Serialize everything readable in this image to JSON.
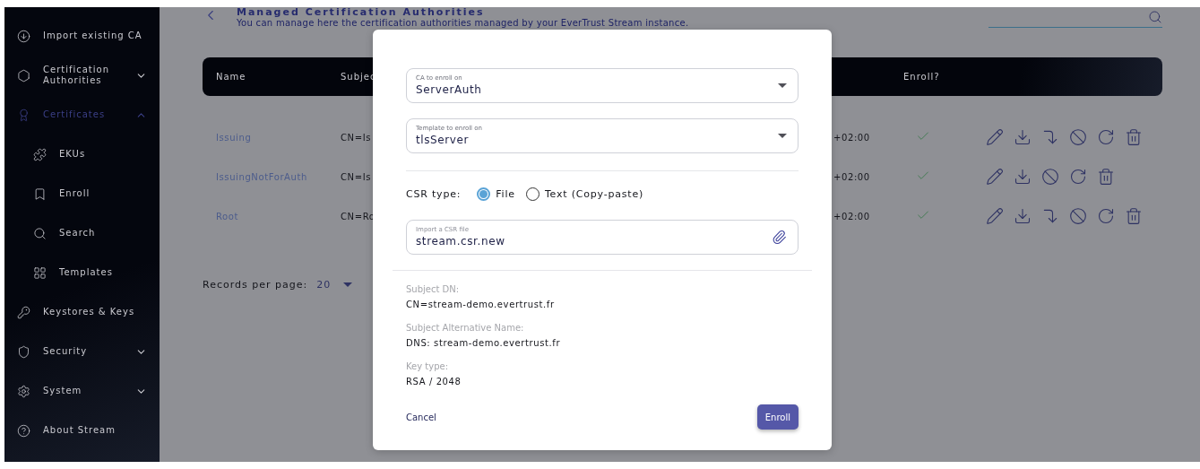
{
  "sidebar": {
    "items": [
      {
        "label": "Import existing CA",
        "selected": false
      },
      {
        "label": "Certification Authorities",
        "selected": false,
        "expanded": false
      },
      {
        "label": "Certificates",
        "selected": true,
        "expanded": true,
        "children": [
          {
            "label": "EKUs",
            "selected": false
          },
          {
            "label": "Enroll",
            "selected": false
          },
          {
            "label": "Search",
            "selected": false
          },
          {
            "label": "Templates",
            "selected": false
          }
        ]
      },
      {
        "label": "Keystores & Keys",
        "selected": false
      },
      {
        "label": "Security",
        "selected": false,
        "expanded": false
      },
      {
        "label": "System",
        "selected": false,
        "expanded": false
      },
      {
        "label": "About Stream",
        "selected": false
      }
    ]
  },
  "page": {
    "title": "Managed Certification Authorities",
    "subtitle": "You can manage here the certification authorities managed by your EverTrust Stream instance."
  },
  "table": {
    "columns": [
      "Name",
      "Subjec",
      "Enroll?"
    ],
    "rows": [
      {
        "name": "Issuing",
        "subject": "CN=Is",
        "date": "+02:00",
        "enroll": true,
        "actions": [
          {
            "kind": "edit"
          },
          {
            "kind": "download"
          },
          {
            "kind": "forward"
          },
          {
            "kind": "revoke"
          },
          {
            "kind": "refresh"
          },
          {
            "kind": "delete"
          }
        ]
      },
      {
        "name": "IssuingNotForAuth",
        "subject": "CN=Is",
        "date": "+02:00",
        "enroll": true,
        "actions": [
          {
            "kind": "edit"
          },
          {
            "kind": "download"
          },
          {
            "kind": "revoke"
          },
          {
            "kind": "refresh"
          },
          {
            "kind": "delete"
          }
        ]
      },
      {
        "name": "Root",
        "subject": "CN=Ro",
        "date": "+02:00",
        "enroll": true,
        "actions": [
          {
            "kind": "edit"
          },
          {
            "kind": "download"
          },
          {
            "kind": "forward"
          },
          {
            "kind": "revoke"
          },
          {
            "kind": "refresh"
          },
          {
            "kind": "delete"
          }
        ]
      }
    ]
  },
  "pagination": {
    "label": "Records per page:",
    "value": "20"
  },
  "dialog": {
    "selects": [
      {
        "label": "CA to enroll on",
        "value": "ServerAuth"
      },
      {
        "label": "Template to enroll on",
        "value": "tlsServer"
      }
    ],
    "csr_type": {
      "label": "CSR type:",
      "options": [
        {
          "label": "File",
          "selected": true
        },
        {
          "label": "Text (Copy-paste)",
          "selected": false
        }
      ]
    },
    "file_field": {
      "label": "Import a CSR file",
      "value": "stream.csr.new"
    },
    "details": [
      {
        "label": "Subject DN:",
        "value": "CN=stream-demo.evertrust.fr"
      },
      {
        "label": "Subject Alternative Name:",
        "value": "DNS: stream-demo.evertrust.fr"
      },
      {
        "label": "Key type:",
        "value": "RSA / 2048"
      }
    ],
    "cancel": "Cancel",
    "submit": "Enroll"
  }
}
